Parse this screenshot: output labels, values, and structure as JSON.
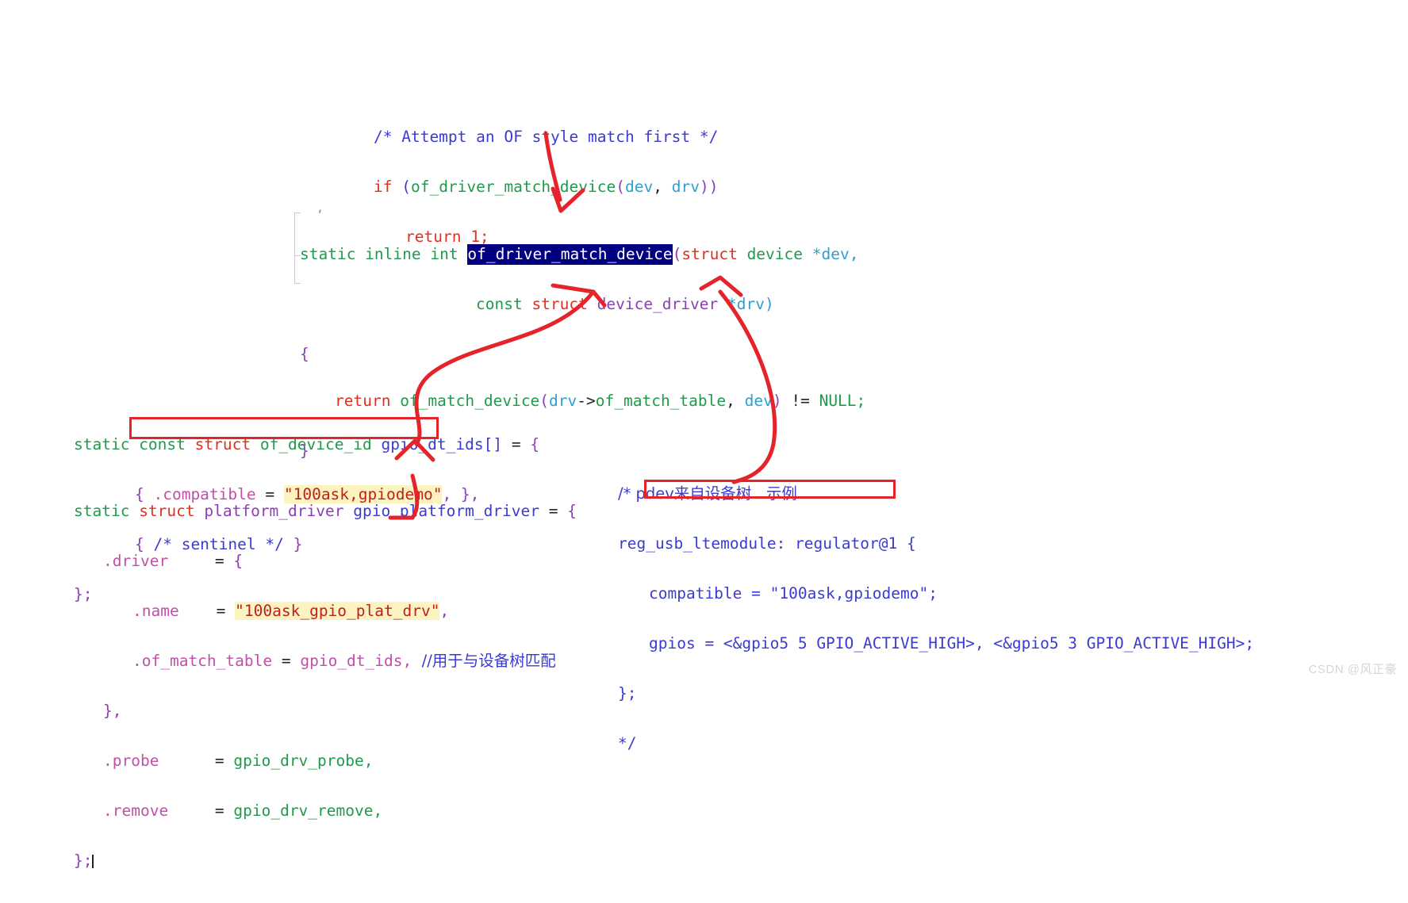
{
  "snippets": {
    "top": {
      "name": "of-style-match-snippet",
      "lines": [
        {
          "comment": "/* Attempt an OF style match first */"
        },
        {
          "kw_if": "if",
          "paren_open": " (",
          "fn": "of_driver_match_device",
          "args_open": "(",
          "arg1": "dev",
          "comma": ", ",
          "arg2": "drv",
          "close": "))"
        },
        {
          "ret": "return",
          "val": " 1;"
        }
      ]
    },
    "middle": {
      "name": "of-driver-match-device-definition",
      "line1": {
        "static": "static",
        "inline": " inline",
        "int": " int ",
        "selected_fn": "of_driver_match_device",
        "open_paren": "(",
        "struct": "struct",
        "type": " device ",
        "ptr_arg": "*dev,"
      },
      "line2": {
        "const": "const",
        "struct": " struct",
        "type": " device_driver ",
        "ptr_arg": "*drv)"
      },
      "line3": "{",
      "line4": {
        "return": "return",
        "fn": " of_match_device",
        "open": "(",
        "arg1": "drv",
        "arrow": "->",
        "member": "of_match_table",
        "comma": ", ",
        "arg2": "dev",
        "close": ")",
        "neq": " != ",
        "null": "NULL;"
      },
      "line5": "}"
    },
    "bottom_left": {
      "name": "gpio-dt-ids-and-platform-driver",
      "dt_ids": {
        "l1": {
          "static": "static",
          "const": " const ",
          "struct": "struct",
          "type": " of_device_id ",
          "ident": "gpio_dt_ids[]",
          "eq": " = ",
          "brace": "{"
        },
        "l2": {
          "brace": "{ ",
          "member": ".compatible",
          "eq": " = ",
          "string": "\"100ask,gpiodemo\"",
          "tail": ", },"
        },
        "l3": {
          "brace": "{ ",
          "comment": "/* sentinel */",
          "tail": " }"
        },
        "l4": "};"
      },
      "platform_driver": {
        "l1": {
          "static": "static ",
          "struct": "struct ",
          "type": "platform_driver ",
          "ident": "gpio_platform_driver",
          "eq": " = ",
          "brace": "{"
        },
        "l2": {
          "member": ".driver",
          "eq": "     = ",
          "brace": "{"
        },
        "l3": {
          "member": ".name",
          "eq": "    = ",
          "string": "\"100ask_gpio_plat_drv\"",
          "tail": ","
        },
        "l4": {
          "member": ".of_match_table",
          "eq": " = ",
          "value": "gpio_dt_ids,",
          "comment": "  //用于与设备树匹配"
        },
        "l5": "},",
        "l6": {
          "member": ".probe",
          "eq": "      = ",
          "value": "gpio_drv_probe,"
        },
        "l7": {
          "member": ".remove",
          "eq": "     = ",
          "value": "gpio_drv_remove,"
        },
        "l8": "};"
      }
    },
    "bottom_right": {
      "name": "device-tree-example-comment",
      "l1": "/* pdev来自设备树   示例",
      "l2": "reg_usb_ltemodule: regulator@1 {",
      "l3": "compatible = \"100ask,gpiodemo\";",
      "l4": "gpios = <&gpio5 5 GPIO_ACTIVE_HIGH>, <&gpio5 3 GPIO_ACTIVE_HIGH>;",
      "l5": "};",
      "l6": "*/"
    }
  },
  "annotations": {
    "redbox_dt_ids": "red-highlight-box-compatible-driver",
    "redbox_devicetree": "red-highlight-box-compatible-devicetree",
    "arrow_down_to_function": "arrow-from-call-to-definition",
    "arrow_to_dt_ids": "arrow-from-of-match-table-to-gpio-dt-ids",
    "arrow_to_devicetree": "arrow-from-dev-to-devicetree-node",
    "arrow_from_of_match_table": "arrow-from-of-match-table-field"
  },
  "watermark": {
    "text": "CSDN @风正豪"
  },
  "colors": {
    "selection_bg": "#000080",
    "highlight_bg": "#fbf3c0",
    "annotation_red": "#e4232b",
    "comment_blue": "#3b3bd0",
    "string_red": "#c02020",
    "keyword_green": "#1f9b4b",
    "struct_red": "#e03020",
    "type_purple": "#8c3fb5",
    "member_pink": "#c050a8"
  }
}
